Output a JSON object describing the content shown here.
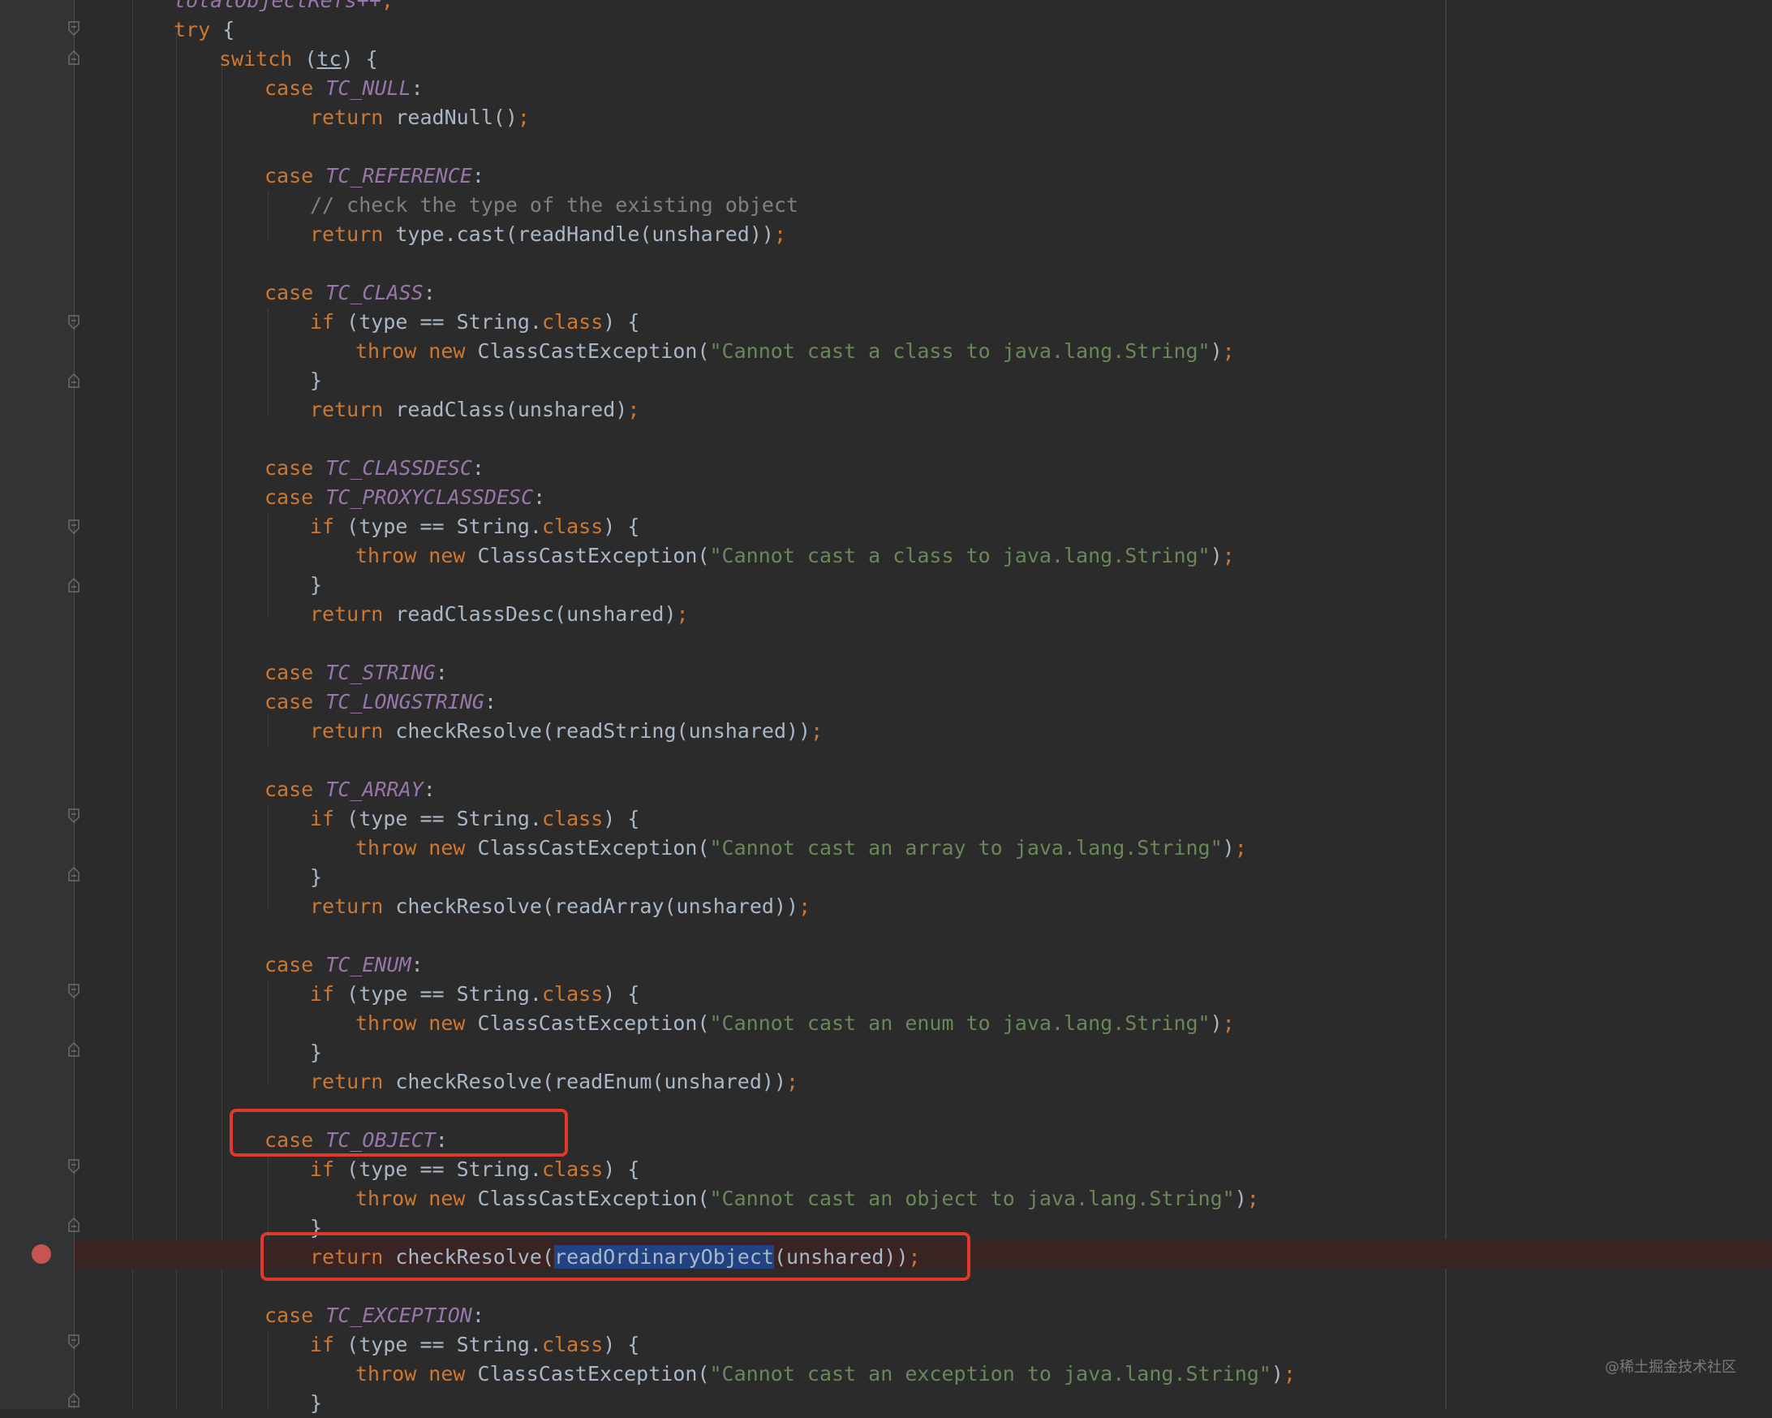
{
  "editor": {
    "language": "java",
    "colors": {
      "background": "#2b2b2b",
      "keyword": "#cc7832",
      "constant": "#9876aa",
      "string": "#6a8759",
      "comment": "#808080",
      "text": "#a9b7c6",
      "highlight_box": "#e0392b",
      "breakpoint": "#c75450",
      "selection": "#214283"
    },
    "lines": [
      {
        "indent": 0,
        "tokens": [
          {
            "t": "totalObjectRefs++",
            "c": "const"
          },
          {
            "t": ";",
            "c": "punc"
          }
        ]
      },
      {
        "indent": 0,
        "tokens": [
          {
            "t": "try",
            "c": "kw"
          },
          {
            "t": " {",
            "c": "plain"
          }
        ]
      },
      {
        "indent": 1,
        "tokens": [
          {
            "t": "switch",
            "c": "kw"
          },
          {
            "t": " (",
            "c": "plain"
          },
          {
            "t": "tc",
            "c": "tc"
          },
          {
            "t": ") {",
            "c": "plain"
          }
        ]
      },
      {
        "indent": 2,
        "tokens": [
          {
            "t": "case ",
            "c": "kw"
          },
          {
            "t": "TC_NULL",
            "c": "const"
          },
          {
            "t": ":",
            "c": "plain"
          }
        ]
      },
      {
        "indent": 3,
        "tokens": [
          {
            "t": "return ",
            "c": "kw"
          },
          {
            "t": "readNull()",
            "c": "plain"
          },
          {
            "t": ";",
            "c": "punc"
          }
        ]
      },
      {
        "indent": 0,
        "tokens": []
      },
      {
        "indent": 2,
        "tokens": [
          {
            "t": "case ",
            "c": "kw"
          },
          {
            "t": "TC_REFERENCE",
            "c": "const"
          },
          {
            "t": ":",
            "c": "plain"
          }
        ]
      },
      {
        "indent": 3,
        "tokens": [
          {
            "t": "// check the type of the existing object",
            "c": "cm"
          }
        ]
      },
      {
        "indent": 3,
        "tokens": [
          {
            "t": "return ",
            "c": "kw"
          },
          {
            "t": "type.cast(readHandle(unshared))",
            "c": "plain"
          },
          {
            "t": ";",
            "c": "punc"
          }
        ]
      },
      {
        "indent": 0,
        "tokens": []
      },
      {
        "indent": 2,
        "tokens": [
          {
            "t": "case ",
            "c": "kw"
          },
          {
            "t": "TC_CLASS",
            "c": "const"
          },
          {
            "t": ":",
            "c": "plain"
          }
        ]
      },
      {
        "indent": 3,
        "tokens": [
          {
            "t": "if",
            "c": "kw"
          },
          {
            "t": " (type == String.",
            "c": "plain"
          },
          {
            "t": "class",
            "c": "kw"
          },
          {
            "t": ") {",
            "c": "plain"
          }
        ]
      },
      {
        "indent": 4,
        "tokens": [
          {
            "t": "throw new ",
            "c": "kw"
          },
          {
            "t": "ClassCastException(",
            "c": "plain"
          },
          {
            "t": "\"Cannot cast a class to java.lang.String\"",
            "c": "str"
          },
          {
            "t": ")",
            "c": "plain"
          },
          {
            "t": ";",
            "c": "punc"
          }
        ]
      },
      {
        "indent": 3,
        "tokens": [
          {
            "t": "}",
            "c": "plain"
          }
        ]
      },
      {
        "indent": 3,
        "tokens": [
          {
            "t": "return ",
            "c": "kw"
          },
          {
            "t": "readClass(unshared)",
            "c": "plain"
          },
          {
            "t": ";",
            "c": "punc"
          }
        ]
      },
      {
        "indent": 0,
        "tokens": []
      },
      {
        "indent": 2,
        "tokens": [
          {
            "t": "case ",
            "c": "kw"
          },
          {
            "t": "TC_CLASSDESC",
            "c": "const"
          },
          {
            "t": ":",
            "c": "plain"
          }
        ]
      },
      {
        "indent": 2,
        "tokens": [
          {
            "t": "case ",
            "c": "kw"
          },
          {
            "t": "TC_PROXYCLASSDESC",
            "c": "const"
          },
          {
            "t": ":",
            "c": "plain"
          }
        ]
      },
      {
        "indent": 3,
        "tokens": [
          {
            "t": "if",
            "c": "kw"
          },
          {
            "t": " (type == String.",
            "c": "plain"
          },
          {
            "t": "class",
            "c": "kw"
          },
          {
            "t": ") {",
            "c": "plain"
          }
        ]
      },
      {
        "indent": 4,
        "tokens": [
          {
            "t": "throw new ",
            "c": "kw"
          },
          {
            "t": "ClassCastException(",
            "c": "plain"
          },
          {
            "t": "\"Cannot cast a class to java.lang.String\"",
            "c": "str"
          },
          {
            "t": ")",
            "c": "plain"
          },
          {
            "t": ";",
            "c": "punc"
          }
        ]
      },
      {
        "indent": 3,
        "tokens": [
          {
            "t": "}",
            "c": "plain"
          }
        ]
      },
      {
        "indent": 3,
        "tokens": [
          {
            "t": "return ",
            "c": "kw"
          },
          {
            "t": "readClassDesc(unshared)",
            "c": "plain"
          },
          {
            "t": ";",
            "c": "punc"
          }
        ]
      },
      {
        "indent": 0,
        "tokens": []
      },
      {
        "indent": 2,
        "tokens": [
          {
            "t": "case ",
            "c": "kw"
          },
          {
            "t": "TC_STRING",
            "c": "const"
          },
          {
            "t": ":",
            "c": "plain"
          }
        ]
      },
      {
        "indent": 2,
        "tokens": [
          {
            "t": "case ",
            "c": "kw"
          },
          {
            "t": "TC_LONGSTRING",
            "c": "const"
          },
          {
            "t": ":",
            "c": "plain"
          }
        ]
      },
      {
        "indent": 3,
        "tokens": [
          {
            "t": "return ",
            "c": "kw"
          },
          {
            "t": "checkResolve(readString(unshared))",
            "c": "plain"
          },
          {
            "t": ";",
            "c": "punc"
          }
        ]
      },
      {
        "indent": 0,
        "tokens": []
      },
      {
        "indent": 2,
        "tokens": [
          {
            "t": "case ",
            "c": "kw"
          },
          {
            "t": "TC_ARRAY",
            "c": "const"
          },
          {
            "t": ":",
            "c": "plain"
          }
        ]
      },
      {
        "indent": 3,
        "tokens": [
          {
            "t": "if",
            "c": "kw"
          },
          {
            "t": " (type == String.",
            "c": "plain"
          },
          {
            "t": "class",
            "c": "kw"
          },
          {
            "t": ") {",
            "c": "plain"
          }
        ]
      },
      {
        "indent": 4,
        "tokens": [
          {
            "t": "throw new ",
            "c": "kw"
          },
          {
            "t": "ClassCastException(",
            "c": "plain"
          },
          {
            "t": "\"Cannot cast an array to java.lang.String\"",
            "c": "str"
          },
          {
            "t": ")",
            "c": "plain"
          },
          {
            "t": ";",
            "c": "punc"
          }
        ]
      },
      {
        "indent": 3,
        "tokens": [
          {
            "t": "}",
            "c": "plain"
          }
        ]
      },
      {
        "indent": 3,
        "tokens": [
          {
            "t": "return ",
            "c": "kw"
          },
          {
            "t": "checkResolve(readArray(unshared))",
            "c": "plain"
          },
          {
            "t": ";",
            "c": "punc"
          }
        ]
      },
      {
        "indent": 0,
        "tokens": []
      },
      {
        "indent": 2,
        "tokens": [
          {
            "t": "case ",
            "c": "kw"
          },
          {
            "t": "TC_ENUM",
            "c": "const"
          },
          {
            "t": ":",
            "c": "plain"
          }
        ]
      },
      {
        "indent": 3,
        "tokens": [
          {
            "t": "if",
            "c": "kw"
          },
          {
            "t": " (type == String.",
            "c": "plain"
          },
          {
            "t": "class",
            "c": "kw"
          },
          {
            "t": ") {",
            "c": "plain"
          }
        ]
      },
      {
        "indent": 4,
        "tokens": [
          {
            "t": "throw new ",
            "c": "kw"
          },
          {
            "t": "ClassCastException(",
            "c": "plain"
          },
          {
            "t": "\"Cannot cast an enum to java.lang.String\"",
            "c": "str"
          },
          {
            "t": ")",
            "c": "plain"
          },
          {
            "t": ";",
            "c": "punc"
          }
        ]
      },
      {
        "indent": 3,
        "tokens": [
          {
            "t": "}",
            "c": "plain"
          }
        ]
      },
      {
        "indent": 3,
        "tokens": [
          {
            "t": "return ",
            "c": "kw"
          },
          {
            "t": "checkResolve(readEnum(unshared))",
            "c": "plain"
          },
          {
            "t": ";",
            "c": "punc"
          }
        ]
      },
      {
        "indent": 0,
        "tokens": []
      },
      {
        "indent": 2,
        "tokens": [
          {
            "t": "case ",
            "c": "kw"
          },
          {
            "t": "TC_OBJECT",
            "c": "const"
          },
          {
            "t": ":",
            "c": "plain"
          }
        ]
      },
      {
        "indent": 3,
        "tokens": [
          {
            "t": "if",
            "c": "kw"
          },
          {
            "t": " (type == String.",
            "c": "plain"
          },
          {
            "t": "class",
            "c": "kw"
          },
          {
            "t": ") {",
            "c": "plain"
          }
        ]
      },
      {
        "indent": 4,
        "tokens": [
          {
            "t": "throw new ",
            "c": "kw"
          },
          {
            "t": "ClassCastException(",
            "c": "plain"
          },
          {
            "t": "\"Cannot cast an object to java.lang.String\"",
            "c": "str"
          },
          {
            "t": ")",
            "c": "plain"
          },
          {
            "t": ";",
            "c": "punc"
          }
        ]
      },
      {
        "indent": 3,
        "tokens": [
          {
            "t": "}",
            "c": "plain"
          }
        ]
      },
      {
        "indent": 3,
        "tokens": [
          {
            "t": "return ",
            "c": "kw"
          },
          {
            "t": "checkResolve(",
            "c": "plain"
          },
          {
            "t": "readOrdinaryObject",
            "c": "sel"
          },
          {
            "t": "(unshared))",
            "c": "plain"
          },
          {
            "t": ";",
            "c": "punc"
          }
        ]
      },
      {
        "indent": 0,
        "tokens": []
      },
      {
        "indent": 2,
        "tokens": [
          {
            "t": "case ",
            "c": "kw"
          },
          {
            "t": "TC_EXCEPTION",
            "c": "const"
          },
          {
            "t": ":",
            "c": "plain"
          }
        ]
      },
      {
        "indent": 3,
        "tokens": [
          {
            "t": "if",
            "c": "kw"
          },
          {
            "t": " (type == String.",
            "c": "plain"
          },
          {
            "t": "class",
            "c": "kw"
          },
          {
            "t": ") {",
            "c": "plain"
          }
        ]
      },
      {
        "indent": 4,
        "tokens": [
          {
            "t": "throw new ",
            "c": "kw"
          },
          {
            "t": "ClassCastException(",
            "c": "plain"
          },
          {
            "t": "\"Cannot cast an exception to java.lang.String\"",
            "c": "str"
          },
          {
            "t": ")",
            "c": "plain"
          },
          {
            "t": ";",
            "c": "punc"
          }
        ]
      },
      {
        "indent": 3,
        "tokens": [
          {
            "t": "}",
            "c": "plain"
          }
        ]
      }
    ],
    "breakpoint_line_number": 45,
    "selected_text": "readOrdinaryObject"
  },
  "watermark": "@稀土掘金技术社区"
}
